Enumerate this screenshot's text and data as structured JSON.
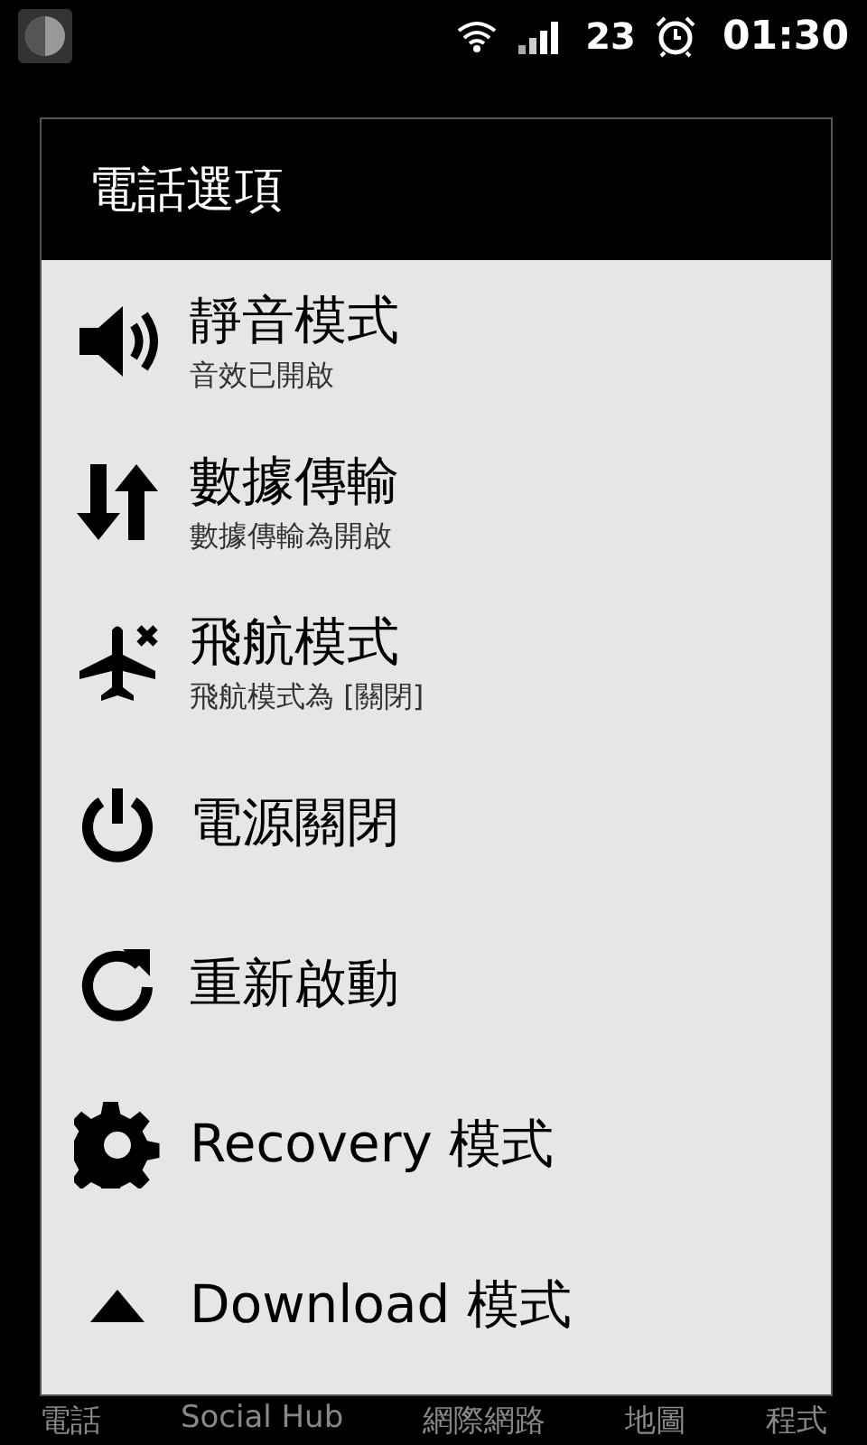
{
  "status_bar": {
    "battery": "23",
    "time": "01:30"
  },
  "dialog": {
    "title": "電話選項",
    "items": [
      {
        "label": "靜音模式",
        "summary": "音效已開啟"
      },
      {
        "label": "數據傳輸",
        "summary": "數據傳輸為開啟"
      },
      {
        "label": "飛航模式",
        "summary": "飛航模式為 [關閉]"
      },
      {
        "label": "電源關閉"
      },
      {
        "label": "重新啟動"
      },
      {
        "label": "Recovery 模式"
      },
      {
        "label": "Download 模式"
      }
    ]
  },
  "dock": [
    "電話",
    "Social Hub",
    "網際網路",
    "地圖",
    "程式"
  ]
}
